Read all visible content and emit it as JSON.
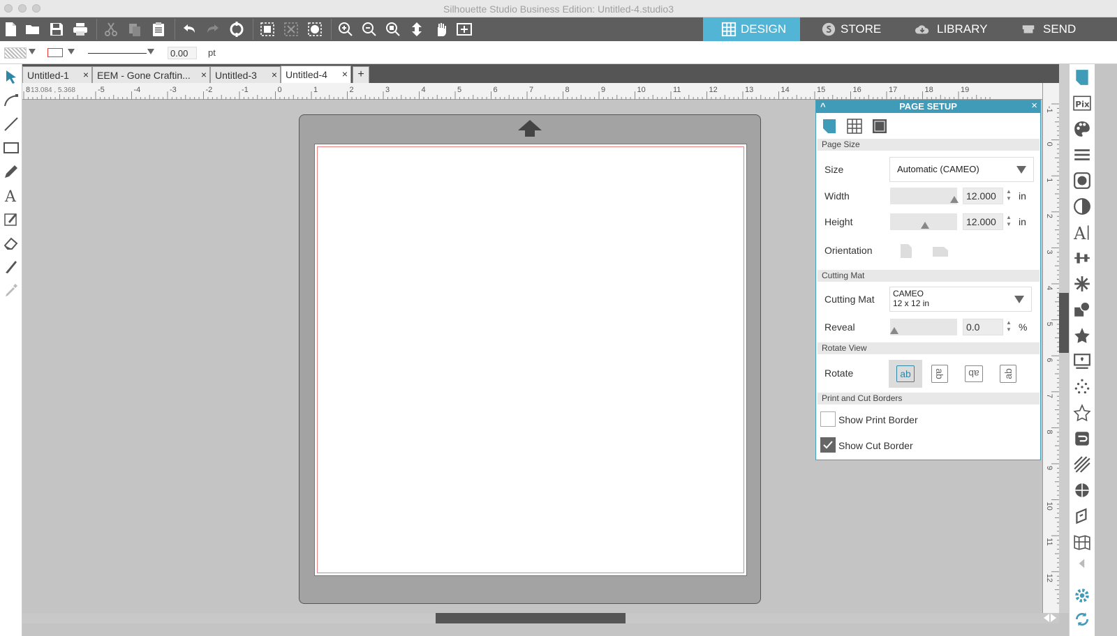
{
  "window": {
    "title": "Silhouette Studio Business Edition: Untitled-4.studio3"
  },
  "toolbar": {
    "icons": [
      "new-file-icon",
      "open-folder-icon",
      "save-icon",
      "print-icon",
      "cut-icon",
      "copy-icon",
      "paste-icon",
      "undo-icon",
      "redo-icon",
      "replicate-icon",
      "group-icon",
      "ungroup-icon",
      "trace-icon",
      "zoom-in-icon",
      "zoom-out-icon",
      "zoom-selection-icon",
      "fit-to-page-icon",
      "pan-icon",
      "add-page-icon"
    ]
  },
  "nav_tabs": [
    {
      "label": "DESIGN",
      "icon": "grid-icon",
      "active": true
    },
    {
      "label": "STORE",
      "icon": "store-icon",
      "active": false
    },
    {
      "label": "LIBRARY",
      "icon": "cloud-icon",
      "active": false
    },
    {
      "label": "SEND",
      "icon": "cutter-icon",
      "active": false
    }
  ],
  "options": {
    "line_width": "0.00",
    "line_unit": "pt",
    "stroke_color": "#e53333"
  },
  "doc_tabs": [
    {
      "label": "Untitled-1",
      "active": false
    },
    {
      "label": "EEM - Gone Craftin...",
      "active": false
    },
    {
      "label": "Untitled-3",
      "active": false
    },
    {
      "label": "Untitled-4",
      "active": true
    }
  ],
  "add_tab_label": "+",
  "close_glyph": "×",
  "ruler": {
    "coords": "13.084 , 5.368",
    "h_labels": [
      "8",
      "-6",
      "-5",
      "-4",
      "-3",
      "-2",
      "-1",
      "0",
      "1",
      "2",
      "3",
      "4",
      "5",
      "6",
      "7",
      "8",
      "9",
      "10",
      "11",
      "12",
      "13",
      "14",
      "15",
      "16",
      "17",
      "18",
      "19"
    ],
    "v_labels": [
      "-1",
      "0",
      "1",
      "2",
      "3",
      "4",
      "5",
      "6",
      "7",
      "8",
      "9",
      "10",
      "11",
      "12"
    ]
  },
  "page_setup": {
    "title": "PAGE SETUP",
    "collapse_glyph": "^",
    "close_glyph": "×",
    "sections": {
      "page_size": "Page Size",
      "cutting_mat": "Cutting Mat",
      "rotate_view": "Rotate View",
      "borders": "Print and Cut Borders"
    },
    "size_label": "Size",
    "size_value": "Automatic (CAMEO)",
    "width_label": "Width",
    "width_value": "12.000",
    "height_label": "Height",
    "height_value": "12.000",
    "dim_unit": "in",
    "orientation_label": "Orientation",
    "mat_label": "Cutting Mat",
    "mat_name": "CAMEO",
    "mat_size": "12 x 12 in",
    "reveal_label": "Reveal",
    "reveal_value": "0.0",
    "reveal_unit": "%",
    "rotate_label": "Rotate",
    "rotate_glyph": "ab",
    "show_print_border": {
      "label": "Show Print Border",
      "checked": false
    },
    "show_cut_border": {
      "label": "Show Cut Border",
      "checked": true
    },
    "accent": "#3f9bb8"
  }
}
